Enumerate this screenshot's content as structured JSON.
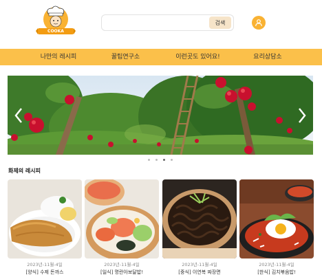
{
  "header": {
    "logo_text": "COOKA",
    "search": {
      "placeholder": "",
      "button_label": "검색"
    }
  },
  "nav": {
    "items": [
      "나만의 레시피",
      "꿀팁연구소",
      "이런곳도 있어요!",
      "요리상담소"
    ]
  },
  "carousel": {
    "slide_count": 4,
    "active_index": 2
  },
  "section": {
    "title": "화제의 레시피"
  },
  "recipes": [
    {
      "date": "2023년-11월-4일",
      "title": "[양식] 수제 돈까스"
    },
    {
      "date": "2023년-11월-4일",
      "title": "[일식] 명란아보달밥!"
    },
    {
      "date": "2023년-11월-4일",
      "title": "[중식] 이연복 짜장면"
    },
    {
      "date": "2023년-11월-4일",
      "title": "[한식] 김치볶음밥!"
    }
  ],
  "colors": {
    "accent": "#fbc04a",
    "user_icon_bg": "#f9b233",
    "search_btn": "#f6e4c9"
  }
}
